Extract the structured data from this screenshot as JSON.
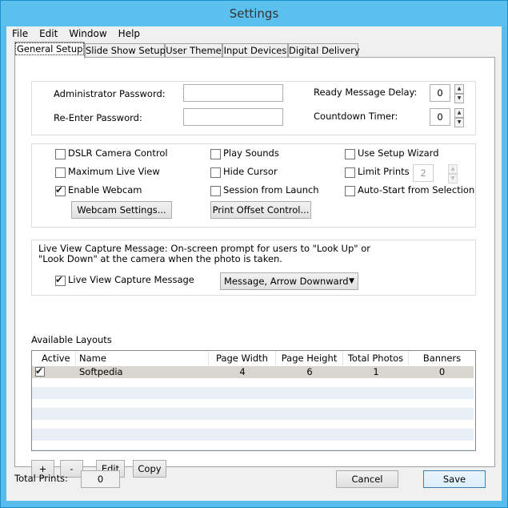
{
  "window": {
    "title": "Settings"
  },
  "menu": [
    "File",
    "Edit",
    "Window",
    "Help"
  ],
  "tabs": [
    "General Setup",
    "Slide Show Setup",
    "User Theme",
    "Input Devices",
    "Digital Delivery"
  ],
  "passwords": {
    "admin_label": "Administrator Password:",
    "reenter_label": "Re-Enter Password:",
    "admin_value": "",
    "reenter_value": ""
  },
  "timers": {
    "ready_label": "Ready Message Delay:",
    "ready_value": "0",
    "countdown_label": "Countdown Timer:",
    "countdown_value": "0"
  },
  "options": {
    "dslr": {
      "label": "DSLR Camera Control",
      "checked": false
    },
    "max_live": {
      "label": "Maximum Live View",
      "checked": false
    },
    "webcam": {
      "label": "Enable Webcam",
      "checked": true
    },
    "sounds": {
      "label": "Play Sounds",
      "checked": false
    },
    "cursor": {
      "label": "Hide Cursor",
      "checked": false
    },
    "session": {
      "label": "Session from Launch",
      "checked": false
    },
    "wizard": {
      "label": "Use Setup Wizard",
      "checked": false
    },
    "limit": {
      "label": "Limit Prints",
      "checked": false
    },
    "autostart": {
      "label": "Auto-Start from Selection",
      "checked": false
    },
    "limit_value": "2",
    "webcam_settings_btn": "Webcam Settings...",
    "print_offset_btn": "Print Offset Control..."
  },
  "liveview": {
    "description_line1": "Live View Capture Message: On-screen prompt for users to \"Look Up\" or",
    "description_line2": "\"Look Down\" at the camera when the photo is taken.",
    "checkbox_label": "Live View Capture Message",
    "checked": true,
    "select_value": "Message, Arrow Downward"
  },
  "layouts": {
    "heading": "Available Layouts",
    "columns": [
      "Active",
      "Name",
      "Page Width",
      "Page Height",
      "Total Photos",
      "Banners"
    ],
    "rows": [
      {
        "active": true,
        "name": "Softpedia",
        "page_width": "4",
        "page_height": "6",
        "total_photos": "1",
        "banners": "0"
      }
    ],
    "buttons": {
      "add": "+",
      "remove": "-",
      "edit": "Edit",
      "copy": "Copy"
    }
  },
  "footer": {
    "total_prints_label": "Total Prints:",
    "total_prints_value": "0",
    "cancel": "Cancel",
    "save": "Save"
  }
}
